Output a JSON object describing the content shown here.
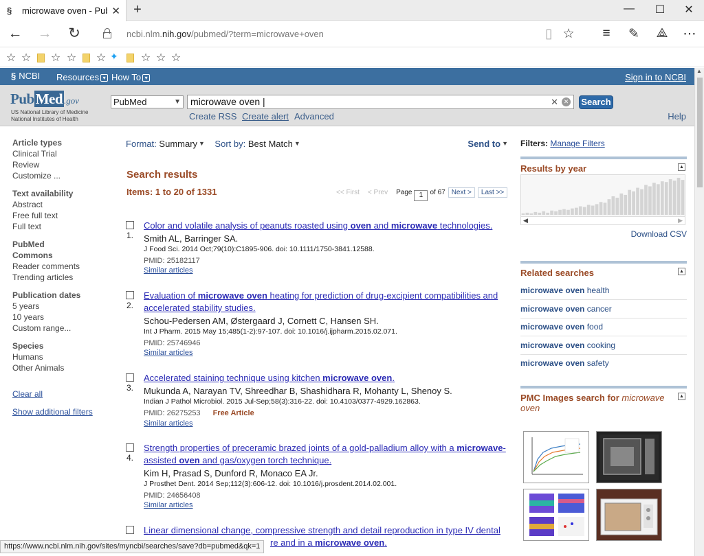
{
  "browser": {
    "tab_title": "microwave oven - PubM",
    "address_domain_prefix": "ncbi.nlm.",
    "address_domain_main": "nih.gov",
    "address_path": "/pubmed/?term=microwave+oven",
    "status_url": "https://www.ncbi.nlm.nih.gov/sites/myncbi/searches/save?db=pubmed&qk=1"
  },
  "ncbi": {
    "logo": "NCBI",
    "resources": "Resources",
    "howto": "How To",
    "signin": "Sign in to NCBI"
  },
  "search": {
    "logo_pub": "Pub",
    "logo_med": "Med",
    "logo_gov": ".gov",
    "logo_sub1": "US National Library of Medicine",
    "logo_sub2": "National Institutes of Health",
    "database": "PubMed",
    "query": "microwave oven",
    "button": "Search",
    "create_rss": "Create RSS",
    "create_alert": "Create alert",
    "advanced": "Advanced",
    "help": "Help"
  },
  "sidebar": {
    "groups": [
      {
        "head": "Article types",
        "items": [
          "Clinical Trial",
          "Review",
          "Customize ..."
        ]
      },
      {
        "head": "Text availability",
        "items": [
          "Abstract",
          "Free full text",
          "Full text"
        ]
      },
      {
        "head": "PubMed Commons",
        "items": [
          "Reader comments",
          "Trending articles"
        ]
      },
      {
        "head": "Publication dates",
        "items": [
          "5 years",
          "10 years",
          "Custom range..."
        ]
      },
      {
        "head": "Species",
        "items": [
          "Humans",
          "Other Animals"
        ]
      }
    ],
    "clear_all": "Clear all",
    "show_more": "Show additional filters"
  },
  "results": {
    "format_label": "Format:",
    "format_value": "Summary",
    "sort_label": "Sort by:",
    "sort_value": "Best Match",
    "send_to": "Send to",
    "heading": "Search results",
    "items": "Items: 1 to 20 of 1331",
    "first": "<< First",
    "prev": "< Prev",
    "page_label": "Page",
    "page_value": "1",
    "of_pages": "of 67",
    "next": "Next >",
    "last": "Last >>",
    "list": [
      {
        "num": "1.",
        "title": "Color and volatile analysis of peanuts roasted using oven and microwave technologies.",
        "authors": "Smith AL, Barringer SA.",
        "cite": "J Food Sci. 2014 Oct;79(10):C1895-906. doi: 10.1111/1750-3841.12588.",
        "pmid": "PMID: 25182117",
        "free": "",
        "similar": "Similar articles"
      },
      {
        "num": "2.",
        "title": "Evaluation of microwave oven heating for prediction of drug-excipient compatibilities and accelerated stability studies.",
        "authors": "Schou-Pedersen AM, Østergaard J, Cornett C, Hansen SH.",
        "cite": "Int J Pharm. 2015 May 15;485(1-2):97-107. doi: 10.1016/j.ijpharm.2015.02.071.",
        "pmid": "PMID: 25746946",
        "free": "",
        "similar": "Similar articles"
      },
      {
        "num": "3.",
        "title": "Accelerated staining technique using kitchen microwave oven.",
        "authors": "Mukunda A, Narayan TV, Shreedhar B, Shashidhara R, Mohanty L, Shenoy S.",
        "cite": "Indian J Pathol Microbiol. 2015 Jul-Sep;58(3):316-22. doi: 10.4103/0377-4929.162863.",
        "pmid": "PMID: 26275253",
        "free": "Free Article",
        "similar": "Similar articles"
      },
      {
        "num": "4.",
        "title": "Strength properties of preceramic brazed joints of a gold-palladium alloy with a microwave-assisted oven and gas/oxygen torch technique.",
        "authors": "Kim H, Prasad S, Dunford R, Monaco EA Jr.",
        "cite": "J Prosthet Dent. 2014 Sep;112(3):606-12. doi: 10.1016/j.prosdent.2014.02.001.",
        "pmid": "PMID: 24656408",
        "free": "",
        "similar": "Similar articles"
      },
      {
        "num": "5.",
        "title": "Linear dimensional change, compressive strength and detail reproduction in type IV dental",
        "authors": "",
        "cite": "",
        "pmid": "",
        "free": "",
        "similar": ""
      }
    ]
  },
  "right": {
    "filters_label": "Filters:",
    "manage_filters": "Manage Filters",
    "results_by_year": "Results by year",
    "download_csv": "Download CSV",
    "related_title": "Related searches",
    "related": [
      {
        "bold": "microwave oven",
        "rest": " health"
      },
      {
        "bold": "microwave oven",
        "rest": " cancer"
      },
      {
        "bold": "microwave oven",
        "rest": " food"
      },
      {
        "bold": "microwave oven",
        "rest": " cooking"
      },
      {
        "bold": "microwave oven",
        "rest": " safety"
      }
    ],
    "pmc_title": "PMC Images search for",
    "pmc_query": "microwave oven",
    "histogram": [
      2,
      3,
      2,
      4,
      3,
      5,
      3,
      6,
      5,
      7,
      8,
      7,
      9,
      10,
      12,
      11,
      14,
      13,
      15,
      18,
      17,
      22,
      26,
      24,
      30,
      28,
      35,
      33,
      38,
      36,
      42,
      40,
      45,
      43,
      47,
      46,
      50,
      48,
      52,
      49
    ]
  }
}
